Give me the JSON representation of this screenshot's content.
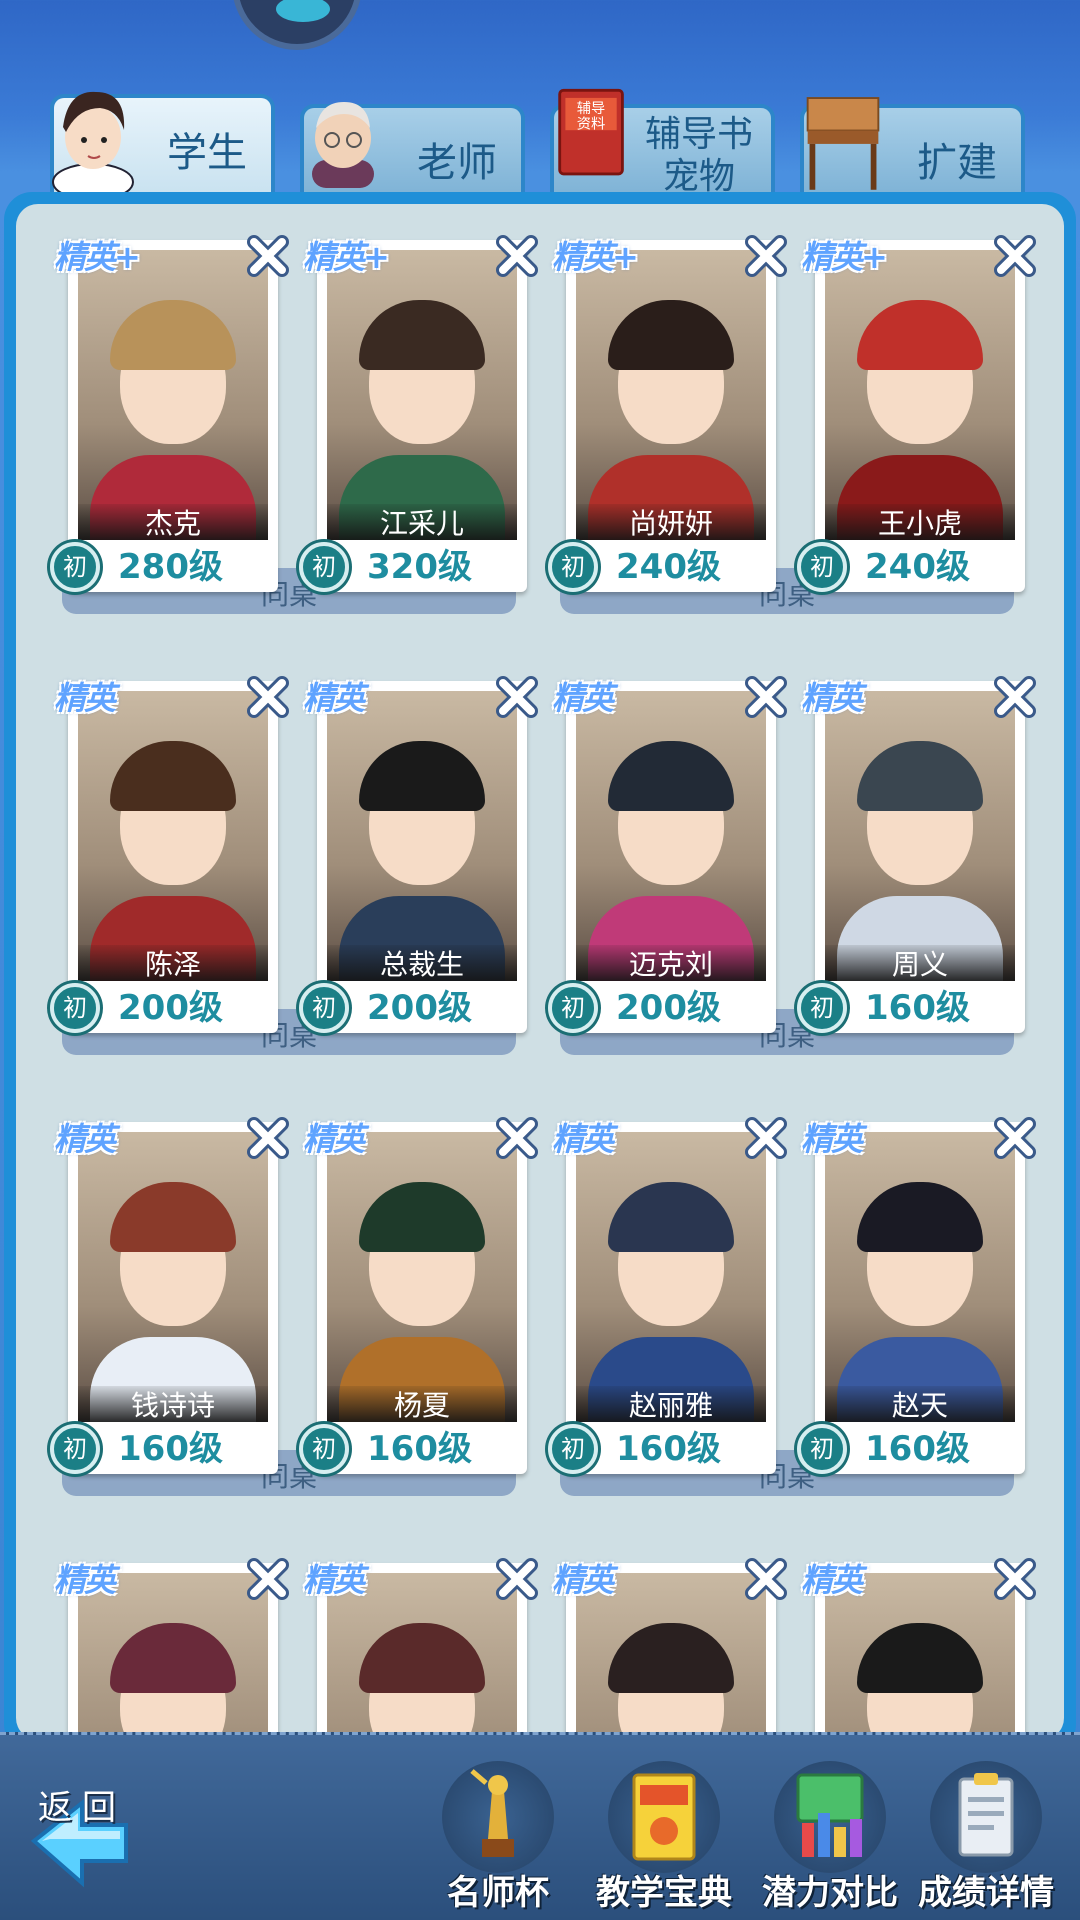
{
  "tabs": [
    {
      "label": "学生",
      "active": true
    },
    {
      "label": "老师",
      "active": false
    },
    {
      "label": "辅导书\n宠物",
      "line1": "辅导书",
      "line2": "宠物",
      "active": false
    },
    {
      "label": "扩建",
      "active": false
    }
  ],
  "book_icon_text": "辅导资料",
  "pair_label": "同桌",
  "students": [
    {
      "name": "杰克",
      "level": "280级",
      "rank": "初",
      "tag": "精英+"
    },
    {
      "name": "江采儿",
      "level": "320级",
      "rank": "初",
      "tag": "精英+"
    },
    {
      "name": "尚妍妍",
      "level": "240级",
      "rank": "初",
      "tag": "精英+"
    },
    {
      "name": "王小虎",
      "level": "240级",
      "rank": "初",
      "tag": "精英+"
    },
    {
      "name": "陈泽",
      "level": "200级",
      "rank": "初",
      "tag": "精英"
    },
    {
      "name": "总裁生",
      "level": "200级",
      "rank": "初",
      "tag": "精英"
    },
    {
      "name": "迈克刘",
      "level": "200级",
      "rank": "初",
      "tag": "精英"
    },
    {
      "name": "周义",
      "level": "160级",
      "rank": "初",
      "tag": "精英"
    },
    {
      "name": "钱诗诗",
      "level": "160级",
      "rank": "初",
      "tag": "精英"
    },
    {
      "name": "杨夏",
      "level": "160级",
      "rank": "初",
      "tag": "精英"
    },
    {
      "name": "赵丽雅",
      "level": "160级",
      "rank": "初",
      "tag": "精英"
    },
    {
      "name": "赵天",
      "level": "160级",
      "rank": "初",
      "tag": "精英"
    },
    {
      "name": "",
      "level": "",
      "rank": "",
      "tag": "精英"
    },
    {
      "name": "",
      "level": "",
      "rank": "",
      "tag": "精英"
    },
    {
      "name": "",
      "level": "",
      "rank": "",
      "tag": "精英"
    },
    {
      "name": "",
      "level": "",
      "rank": "",
      "tag": "精英"
    }
  ],
  "bottom_nav": {
    "back_label": "返回",
    "items": [
      {
        "label": "名师杯",
        "icon": "trophy-icon"
      },
      {
        "label": "教学宝典",
        "icon": "book-icon"
      },
      {
        "label": "潜力对比",
        "icon": "bar-chart-icon"
      },
      {
        "label": "成绩详情",
        "icon": "report-card-icon"
      }
    ]
  },
  "colors": {
    "panel_border": "#1f8fd8",
    "level_text": "#1e8da0",
    "elite_tag": "#5fa3ff",
    "pair_bar": "#8ea7c6"
  }
}
